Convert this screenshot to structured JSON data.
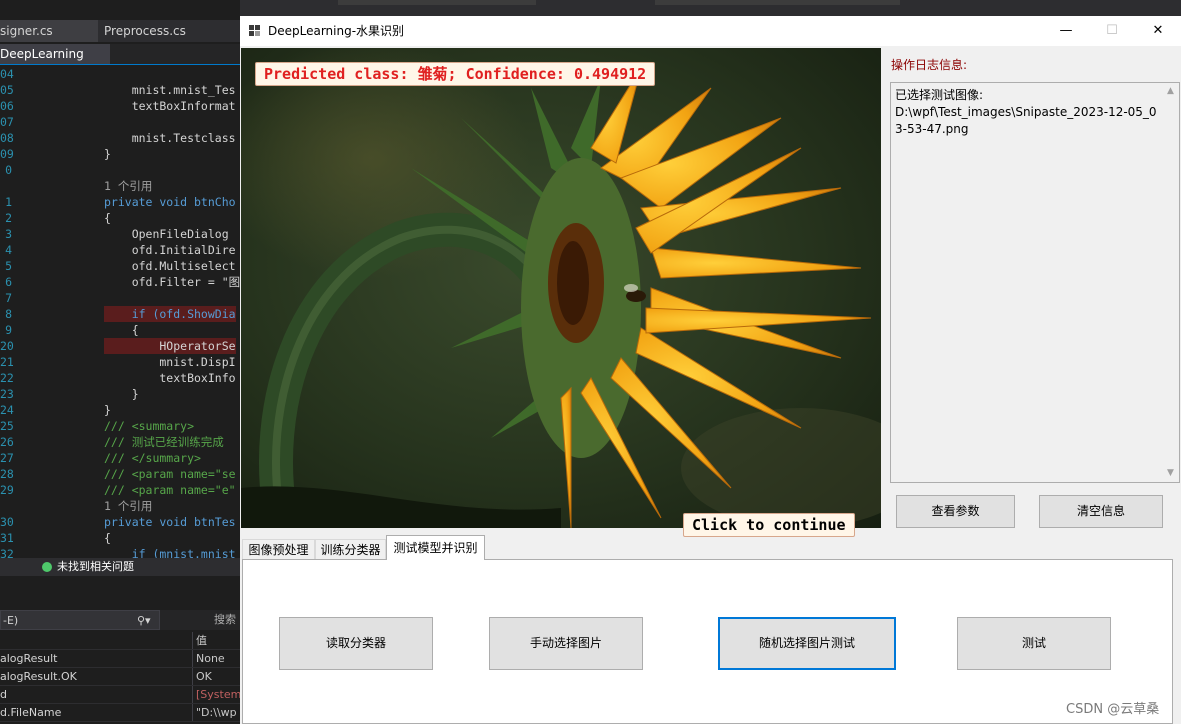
{
  "ide": {
    "tabs": [
      "signer.cs",
      "Preprocess.cs"
    ],
    "project": "DeepLearning",
    "code_lines": [
      {
        "ln": "04",
        "text": ""
      },
      {
        "ln": "05",
        "text": "    mnist.mnist_Tes"
      },
      {
        "ln": "06",
        "text": "    textBoxInformat"
      },
      {
        "ln": "07",
        "text": ""
      },
      {
        "ln": "08",
        "text": "    mnist.Testclass"
      },
      {
        "ln": "09",
        "text": "}"
      },
      {
        "ln": "0",
        "text": ""
      },
      {
        "ln": "",
        "text": "1 个引用"
      },
      {
        "ln": "1",
        "text": "private void btnCho"
      },
      {
        "ln": "2",
        "text": "{"
      },
      {
        "ln": "3",
        "text": "    OpenFileDialog "
      },
      {
        "ln": "4",
        "text": "    ofd.InitialDire"
      },
      {
        "ln": "5",
        "text": "    ofd.Multiselect"
      },
      {
        "ln": "6",
        "text": "    ofd.Filter = \"图"
      },
      {
        "ln": "7",
        "text": ""
      },
      {
        "ln": "8",
        "text": "    if (ofd.ShowDia"
      },
      {
        "ln": "9",
        "text": "    {"
      },
      {
        "ln": "20",
        "text": "        HOperatorSe"
      },
      {
        "ln": "21",
        "text": "        mnist.DispI"
      },
      {
        "ln": "22",
        "text": "        textBoxInfo"
      },
      {
        "ln": "23",
        "text": "    }"
      },
      {
        "ln": "24",
        "text": "}"
      },
      {
        "ln": "25",
        "text": "/// <summary>"
      },
      {
        "ln": "26",
        "text": "/// 测试已经训练完成"
      },
      {
        "ln": "27",
        "text": "/// </summary>"
      },
      {
        "ln": "28",
        "text": "/// <param name=\"se"
      },
      {
        "ln": "29",
        "text": "/// <param name=\"e\""
      },
      {
        "ln": "",
        "text": "1 个引用"
      },
      {
        "ln": "30",
        "text": "private void btnTes"
      },
      {
        "ln": "31",
        "text": "{"
      },
      {
        "ln": "32",
        "text": "    if (mnist.mnist"
      }
    ],
    "status_text": "未找到相关问题",
    "search_label": "-E)",
    "search_hint": "搜索",
    "locals_header_value": "值",
    "locals": [
      {
        "name": "alogResult",
        "value": "None"
      },
      {
        "name": "alogResult.OK",
        "value": "OK"
      },
      {
        "name": "d",
        "value": "[System"
      },
      {
        "name": "d.FileName",
        "value": "\"D:\\\\wp"
      }
    ]
  },
  "window": {
    "title": "DeepLearning-水果识别",
    "minimize": "—",
    "maximize": "☐",
    "close": "✕"
  },
  "picture": {
    "predicted_text": "Predicted class: 雏菊;  Confidence: 0.494912",
    "continue_text": "Click to continue"
  },
  "log": {
    "title": "操作日志信息:",
    "content": "已选择测试图像:\nD:\\wpf\\Test_images\\Snipaste_2023-12-05_03-53-47.png",
    "scroll_up": "▲",
    "scroll_down": "▼"
  },
  "buttons": {
    "view_params": "查看参数",
    "clear_info": "清空信息",
    "read_classifier": "读取分类器",
    "manual_select": "手动选择图片",
    "random_select": "随机选择图片测试",
    "test": "测试"
  },
  "tabs": [
    {
      "label": "图像预处理",
      "active": false
    },
    {
      "label": "训练分类器",
      "active": false
    },
    {
      "label": "测试模型并识别",
      "active": true
    }
  ],
  "watermark": "CSDN @云草桑"
}
